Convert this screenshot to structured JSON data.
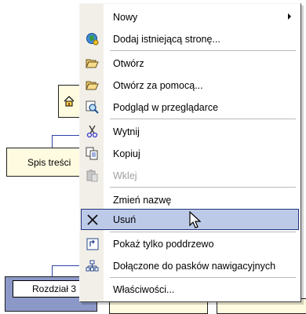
{
  "diagram": {
    "home_icon": "home-icon",
    "node_spis": "Spis treści",
    "node_rozdzial": "Rozdział 3"
  },
  "menu": {
    "items": [
      {
        "label": "Nowy",
        "mnemonic": "N",
        "icon": "none",
        "has_submenu": true
      },
      {
        "label": "Dodaj istniejącą stronę...",
        "mnemonic": "D",
        "icon": "globe-icon"
      },
      {
        "label": "Otwórz",
        "mnemonic": "O",
        "icon": "folder-open-icon"
      },
      {
        "label": "Otwórz za pomocą...",
        "mnemonic": "O",
        "icon": "folder-open-icon"
      },
      {
        "label": "Podgląd w przeglądarce",
        "mnemonic": "P",
        "icon": "preview-magnifier-icon"
      },
      {
        "label": "Wytnij",
        "mnemonic": "n",
        "icon": "scissors-icon"
      },
      {
        "label": "Kopiuj",
        "mnemonic": "K",
        "icon": "copy-icon"
      },
      {
        "label": "Wklej",
        "mnemonic": "W",
        "icon": "paste-icon",
        "disabled": true
      },
      {
        "label": "Zmień nazwę",
        "mnemonic": "m",
        "icon": "none"
      },
      {
        "label": "Usuń",
        "mnemonic": "U",
        "icon": "delete-x-icon",
        "highlighted": true
      },
      {
        "label": "Pokaż tylko poddrzewo",
        "mnemonic": "P",
        "icon": "subtree-icon"
      },
      {
        "label": "Dołączone do pasków nawigacyjnych",
        "mnemonic": "D",
        "icon": "navigation-bar-icon"
      },
      {
        "label": "Właściwości...",
        "mnemonic": "c",
        "icon": "none"
      }
    ]
  },
  "colors": {
    "highlight_bg": "#bccae8",
    "highlight_border": "#23337a",
    "gutter": "#f1efe8",
    "connector_line": "#2f43a8",
    "node_fill": "#fffbe0"
  }
}
